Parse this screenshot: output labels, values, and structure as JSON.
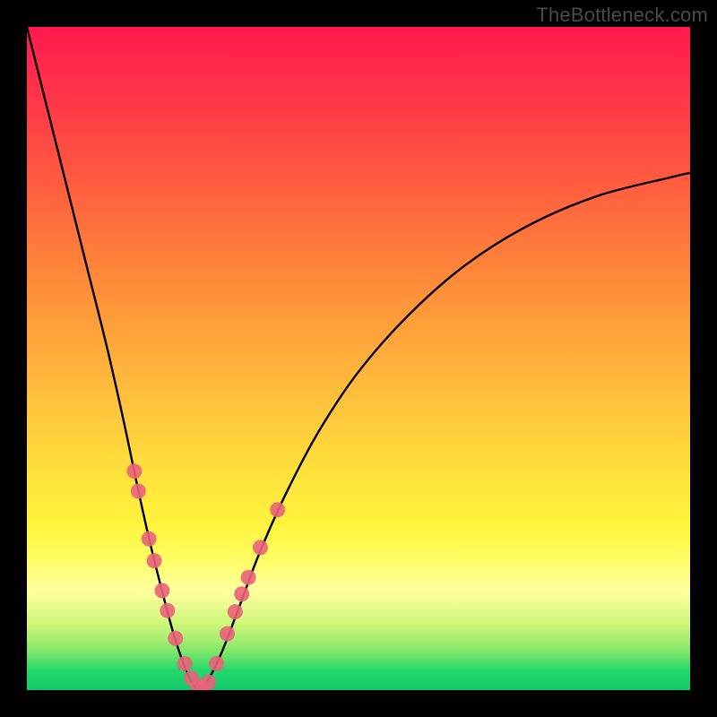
{
  "watermark": "TheBottleneck.com",
  "chart_data": {
    "type": "line",
    "title": "",
    "xlabel": "",
    "ylabel": "",
    "xlim": [
      0,
      1
    ],
    "ylim": [
      0,
      1
    ],
    "series": [
      {
        "name": "curve-left",
        "x": [
          0.0,
          0.03,
          0.06,
          0.09,
          0.12,
          0.145,
          0.165,
          0.185,
          0.205,
          0.222,
          0.238,
          0.25,
          0.262
        ],
        "y": [
          1.0,
          0.88,
          0.76,
          0.64,
          0.52,
          0.41,
          0.315,
          0.225,
          0.145,
          0.082,
          0.035,
          0.01,
          0.0
        ]
      },
      {
        "name": "curve-right",
        "x": [
          0.262,
          0.275,
          0.295,
          0.32,
          0.35,
          0.39,
          0.44,
          0.5,
          0.575,
          0.66,
          0.755,
          0.86,
          0.97,
          1.0
        ],
        "y": [
          0.0,
          0.018,
          0.06,
          0.125,
          0.205,
          0.295,
          0.39,
          0.48,
          0.565,
          0.64,
          0.7,
          0.745,
          0.773,
          0.78
        ]
      }
    ],
    "markers": [
      {
        "x": 0.162,
        "y": 0.33
      },
      {
        "x": 0.168,
        "y": 0.3
      },
      {
        "x": 0.184,
        "y": 0.228
      },
      {
        "x": 0.192,
        "y": 0.195
      },
      {
        "x": 0.204,
        "y": 0.15
      },
      {
        "x": 0.212,
        "y": 0.12
      },
      {
        "x": 0.224,
        "y": 0.078
      },
      {
        "x": 0.238,
        "y": 0.04
      },
      {
        "x": 0.248,
        "y": 0.018
      },
      {
        "x": 0.258,
        "y": 0.006
      },
      {
        "x": 0.266,
        "y": 0.004
      },
      {
        "x": 0.274,
        "y": 0.012
      },
      {
        "x": 0.286,
        "y": 0.04
      },
      {
        "x": 0.302,
        "y": 0.085
      },
      {
        "x": 0.314,
        "y": 0.118
      },
      {
        "x": 0.324,
        "y": 0.145
      },
      {
        "x": 0.334,
        "y": 0.17
      },
      {
        "x": 0.352,
        "y": 0.215
      },
      {
        "x": 0.378,
        "y": 0.272
      }
    ],
    "colors": {
      "curve": "#000000",
      "marker": "#e9637a",
      "gradient_top": "#ff1a4d",
      "gradient_bottom": "#10c96a"
    }
  }
}
